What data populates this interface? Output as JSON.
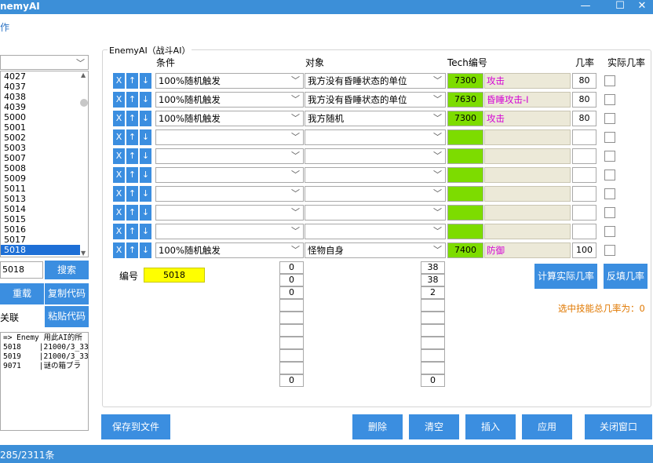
{
  "window": {
    "title": "nemyAI",
    "menu": "操作"
  },
  "left": {
    "list": [
      "4027",
      "4037",
      "4038",
      "4039",
      "5000",
      "5001",
      "5002",
      "5003",
      "5007",
      "5008",
      "5009",
      "5011",
      "5013",
      "5014",
      "5015",
      "5016",
      "5017",
      "5018"
    ],
    "selected_index": 17,
    "search_value": "5018",
    "search_label": "搜索",
    "reload_label": "重载",
    "copy_label": "复制代码",
    "relation_label": "关联",
    "paste_label": "粘贴代码",
    "code_lines": [
      "=> Enemy 用此AI的所",
      "5018    |21000/3_33",
      "5019    |21000/3_33",
      "9071    |谜の箱ブラ"
    ]
  },
  "group_title": "EnemyAI（战斗AI）",
  "headers": {
    "condition": "条件",
    "target": "对象",
    "tech": "Tech编号",
    "rate": "几率",
    "actual_rate": "实际几率"
  },
  "row_btns": {
    "x": "X",
    "up": "↑",
    "down": "↓"
  },
  "rows": [
    {
      "condition": "100%随机触发",
      "target": "我方没有昏睡状态的单位",
      "tech": "7300",
      "tech_name": "攻击",
      "rate": "80"
    },
    {
      "condition": "100%随机触发",
      "target": "我方没有昏睡状态的单位",
      "tech": "7630",
      "tech_name": "昏睡攻击-Ⅰ",
      "rate": "80"
    },
    {
      "condition": "100%随机触发",
      "target": "我方随机",
      "tech": "7300",
      "tech_name": "攻击",
      "rate": "80"
    },
    {
      "condition": "",
      "target": "",
      "tech": "",
      "tech_name": "",
      "rate": ""
    },
    {
      "condition": "",
      "target": "",
      "tech": "",
      "tech_name": "",
      "rate": ""
    },
    {
      "condition": "",
      "target": "",
      "tech": "",
      "tech_name": "",
      "rate": ""
    },
    {
      "condition": "",
      "target": "",
      "tech": "",
      "tech_name": "",
      "rate": ""
    },
    {
      "condition": "",
      "target": "",
      "tech": "",
      "tech_name": "",
      "rate": ""
    },
    {
      "condition": "",
      "target": "",
      "tech": "",
      "tech_name": "",
      "rate": ""
    },
    {
      "condition": "100%随机触发",
      "target": "怪物自身",
      "tech": "7400",
      "tech_name": "防御",
      "rate": "100"
    }
  ],
  "id_label": "编号",
  "id_value": "5018",
  "num_col1": [
    "0",
    "0",
    "0",
    "",
    "",
    "",
    "",
    "",
    "",
    "0"
  ],
  "num_col2": [
    "38",
    "38",
    "2",
    "",
    "",
    "",
    "",
    "",
    "",
    "0"
  ],
  "calc_label": "计算实际几率",
  "backfill_label": "反填几率",
  "sum_text": "选中技能总几率为：0",
  "bottom": {
    "save": "保存到文件",
    "delete": "删除",
    "clear": "清空",
    "insert": "插入",
    "apply": "应用",
    "close": "关闭窗口"
  },
  "status": "285/2311条"
}
